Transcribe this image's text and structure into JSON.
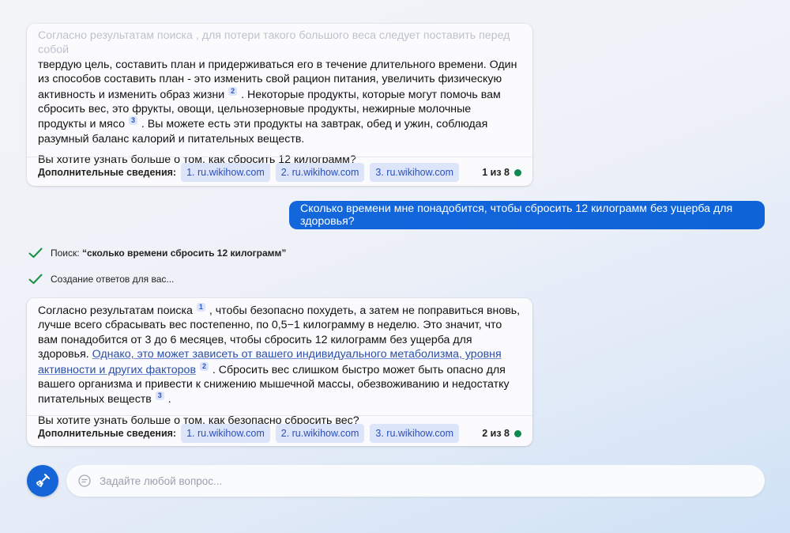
{
  "message_1": {
    "faded_top": "Согласно результатам поиска , для потери такого большого веса следует поставить перед собой",
    "line_a": "твердую цель, составить план и придерживаться его в течение длительного времени. Один из способов составить план - это изменить свой рацион питания, увеличить физическую активность и изменить образ жизни",
    "cite_a": "2",
    "line_b": ". Некоторые продукты, которые могут помочь вам сбросить вес, это фрукты, овощи, цельнозерновые продукты, нежирные молочные продукты и мясо",
    "cite_b": "3",
    "line_c": ". Вы можете есть эти продукты на завтрак, обед и ужин, соблюдая разумный баланс калорий и питательных веществ.",
    "question": "Вы хотите узнать больше о том, как сбросить 12 килограмм?",
    "refs_label": "Дополнительные сведения:",
    "refs": [
      "1. ru.wikihow.com",
      "2. ru.wikihow.com",
      "3. ru.wikihow.com"
    ],
    "counter": "1 из 8"
  },
  "user_message": "Сколько времени мне понадобится, чтобы сбросить 12 килограмм без ущерба для здоровья?",
  "status": {
    "search_prefix": "Поиск: ",
    "search_query": "“сколько времени сбросить 12 килограмм”",
    "generating": "Создание ответов для вас..."
  },
  "message_2": {
    "part_1": "Согласно результатам поиска",
    "cite_1": "1",
    "part_2": ", чтобы безопасно похудеть, а затем не поправиться вновь, лучше всего сбрасывать вес постепенно, по 0,5−1 килограмму в неделю. Это значит, что вам понадобится от 3 до 6 месяцев, чтобы сбросить 12 килограмм без ущерба для здоровья.",
    "highlight": "Однако, это может зависеть от вашего индивидуального метаболизма, уровня активности и других факторов",
    "cite_2": "2",
    "part_3": ". Сбросить вес слишком быстро может быть опасно для вашего организма и привести к снижению мышечной массы, обезвоживанию и недостатку питательных веществ",
    "cite_3": "3",
    "part_4": ".",
    "question": "Вы хотите узнать больше о том, как безопасно сбросить вес?",
    "refs_label": "Дополнительные сведения:",
    "refs": [
      "1. ru.wikihow.com",
      "2. ru.wikihow.com",
      "3. ru.wikihow.com"
    ],
    "counter": "2 из 8"
  },
  "input": {
    "placeholder": "Задайте любой вопрос..."
  },
  "colors": {
    "accent": "#0f6cdb",
    "chip_bg": "#dde5fb",
    "status_ok": "#0d8a4f"
  },
  "icons": {
    "check": "check-icon",
    "broom": "broom-icon",
    "chat": "chat-bubble-icon"
  }
}
